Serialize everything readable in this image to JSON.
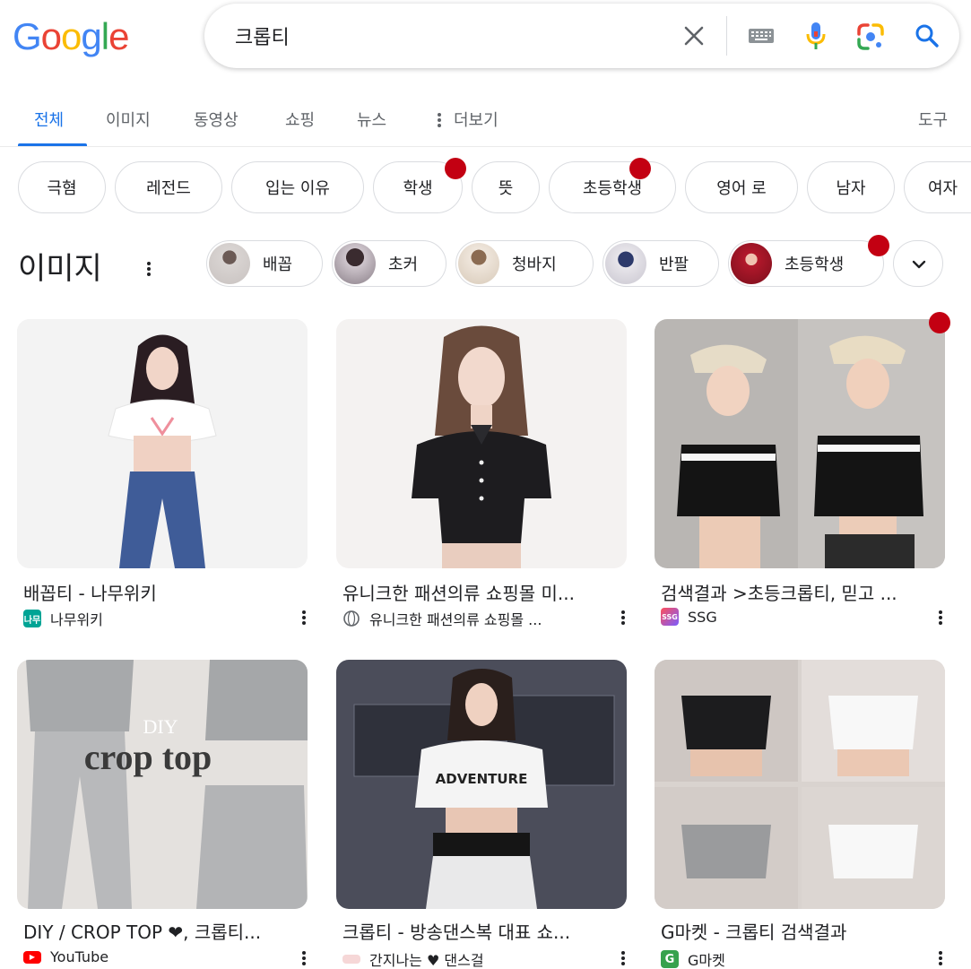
{
  "header": {
    "logo_letters": [
      "G",
      "o",
      "o",
      "g",
      "l",
      "e"
    ],
    "logo_colors": [
      "#4285f4",
      "#ea4335",
      "#fbbc05",
      "#4285f4",
      "#34a853",
      "#ea4335"
    ],
    "query": "크롭티"
  },
  "nav": {
    "tabs": [
      "전체",
      "이미지",
      "동영상",
      "쇼핑",
      "뉴스",
      "더보기"
    ],
    "tools": "도구",
    "active_color": "#1a73e8"
  },
  "filter_chips": [
    "극혐",
    "레전드",
    "입는 이유",
    "학생",
    "뜻",
    "초등학생",
    "영어 로",
    "남자",
    "여자"
  ],
  "images_section": {
    "title": "이미지",
    "chips": [
      "배꼽",
      "초커",
      "청바지",
      "반팔",
      "초등학생"
    ]
  },
  "results": [
    {
      "title": "배꼽티 - 나무위키",
      "source": "나무위키",
      "favicon_text": "나무",
      "favicon_color": "#00a495"
    },
    {
      "title": "유니크한 패션의류 쇼핑몰 미...",
      "source": "유니크한 패션의류 쇼핑몰 ...",
      "favicon_text": "",
      "favicon_color": "#5f6368"
    },
    {
      "title": "검색결과 >초등크롭티, 믿고 ...",
      "source": "SSG",
      "favicon_text": "SSG",
      "favicon_color": "#ff5a5f"
    },
    {
      "title": "DIY / CROP TOP ❤, 크롭티...",
      "source": "YouTube",
      "favicon_text": "▶",
      "favicon_color": "#ff0000"
    },
    {
      "title": "크롭티 - 방송댄스복 대표 쇼...",
      "source": "간지나는 ♥ 댄스걸",
      "favicon_text": "",
      "favicon_color": "#f6b6b6"
    },
    {
      "title": "G마켓 - 크롭티 검색결과",
      "source": "G마켓",
      "favicon_text": "G",
      "favicon_color": "#37a24d"
    }
  ],
  "image_text": {
    "diy": "DIY",
    "crop_top": "crop top",
    "adventure": "ADVENTURE"
  },
  "marker_color": "#c30012"
}
